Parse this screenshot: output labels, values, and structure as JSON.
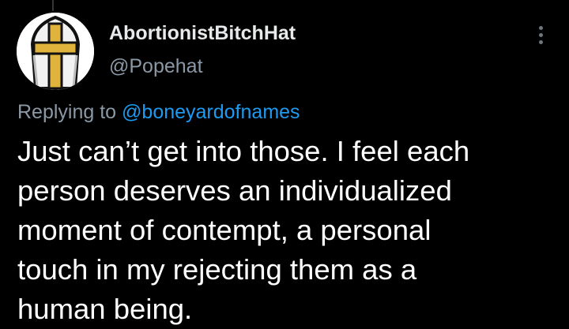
{
  "tweet": {
    "author": {
      "display_name": "AbortionistBitchHat",
      "handle": "@Popehat",
      "avatar_icon": "papal-mitre-icon"
    },
    "more_icon": "more-options-icon",
    "reply_prefix": "Replying to",
    "reply_to": "@boneyardofnames",
    "text_lines": [
      "Just can’t get into those. I feel each",
      "person deserves an individualized",
      "moment of contempt, a personal",
      "touch in my rejecting them as a",
      "human being."
    ]
  },
  "colors": {
    "background": "#000000",
    "text_primary": "#e7e9ea",
    "text_secondary": "#8b98a5",
    "link": "#1d9bf0",
    "mitre_gold": "#e0b43c"
  }
}
